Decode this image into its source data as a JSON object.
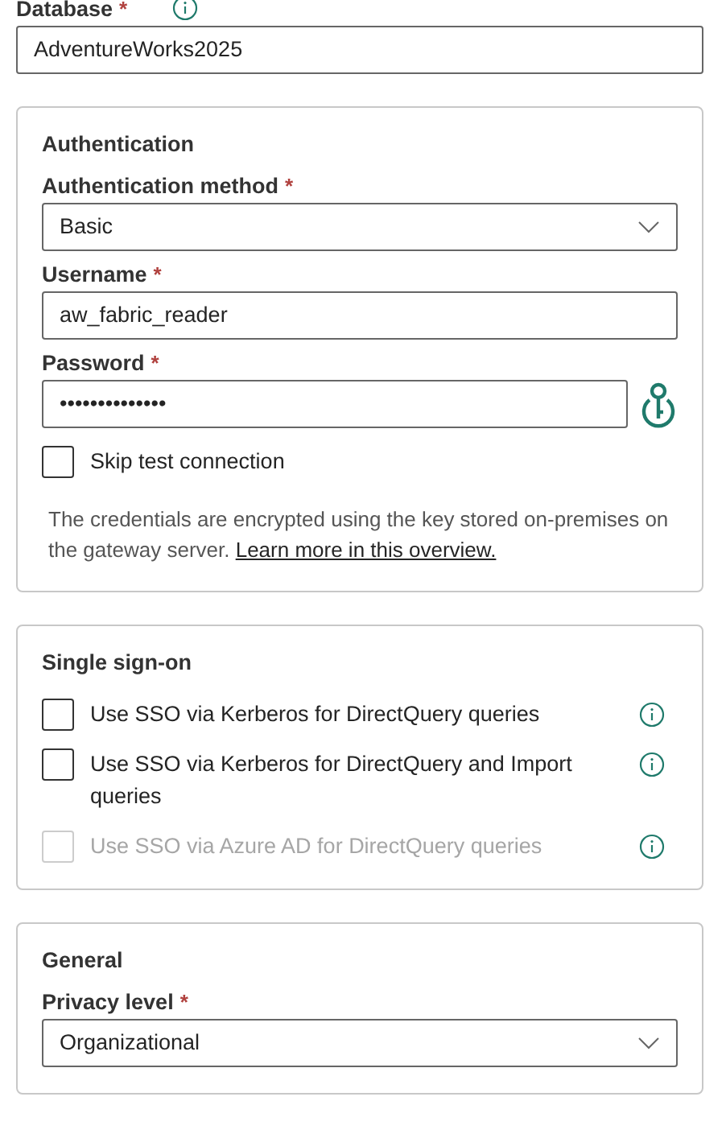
{
  "database": {
    "label": "Database",
    "required_mark": "*",
    "info": true,
    "value": "AdventureWorks2025"
  },
  "sections": [
    {
      "title": "Authentication",
      "fields": [
        {
          "kind": "dropdown",
          "label": "Authentication method",
          "required_mark": "*",
          "value": "Basic"
        },
        {
          "kind": "text",
          "label": "Username",
          "required_mark": "*",
          "value": "aw_fabric_reader"
        },
        {
          "kind": "password",
          "label": "Password",
          "required_mark": "*",
          "value": "••••••••••••••"
        },
        {
          "kind": "checkbox",
          "label": "Skip test connection",
          "checked": false,
          "disabled": false,
          "info": false
        },
        {
          "kind": "note",
          "text": "The credentials are encrypted using the key stored on-premises on the gateway server.",
          "link": "Learn more in this overview."
        }
      ]
    },
    {
      "title": "Single sign-on",
      "fields": [
        {
          "kind": "checkbox",
          "label": "Use SSO via Kerberos for DirectQuery queries",
          "checked": false,
          "disabled": false,
          "info": true
        },
        {
          "kind": "checkbox",
          "label": "Use SSO via Kerberos for DirectQuery and Import queries",
          "checked": false,
          "disabled": false,
          "info": true
        },
        {
          "kind": "checkbox",
          "label": "Use SSO via Azure AD for DirectQuery queries",
          "checked": false,
          "disabled": true,
          "info": true
        }
      ]
    },
    {
      "title": "General",
      "fields": [
        {
          "kind": "dropdown",
          "label": "Privacy level",
          "required_mark": "*",
          "value": "Organizational"
        }
      ]
    }
  ]
}
